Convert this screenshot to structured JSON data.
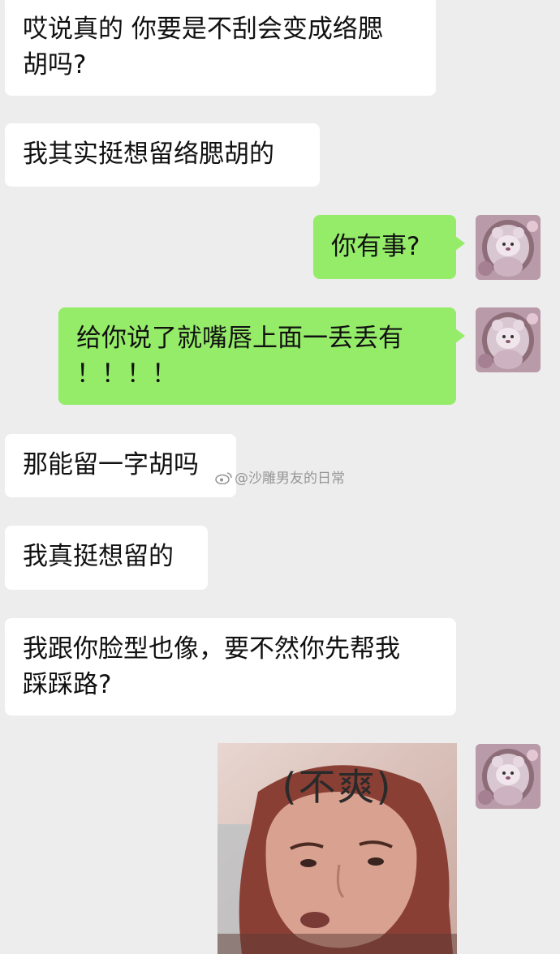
{
  "messages": [
    {
      "side": "in",
      "lines": [
        "哎说真的 你要是不刮会变成络腮",
        "胡吗?"
      ]
    },
    {
      "side": "in",
      "lines": [
        "我其实挺想留络腮胡的"
      ]
    },
    {
      "side": "out",
      "lines": [
        "你有事?"
      ]
    },
    {
      "side": "out",
      "lines": [
        "给你说了就嘴唇上面一丢丢有",
        "！！！！"
      ]
    },
    {
      "side": "in",
      "lines": [
        "那能留一字胡吗"
      ]
    },
    {
      "side": "in",
      "lines": [
        "我真挺想留的"
      ]
    },
    {
      "side": "in",
      "lines": [
        "我跟你脸型也像，要不然你先帮我",
        "踩踩路?"
      ]
    }
  ],
  "sticker": {
    "caption": "(不爽)"
  },
  "watermark": {
    "text": "@沙雕男友的日常"
  },
  "icons": {
    "avatar": "plush-bear-avatar-icon",
    "watermark": "weibo-logo-icon"
  },
  "colors": {
    "background": "#ededed",
    "incoming_bubble": "#ffffff",
    "outgoing_bubble": "#95ec69"
  }
}
